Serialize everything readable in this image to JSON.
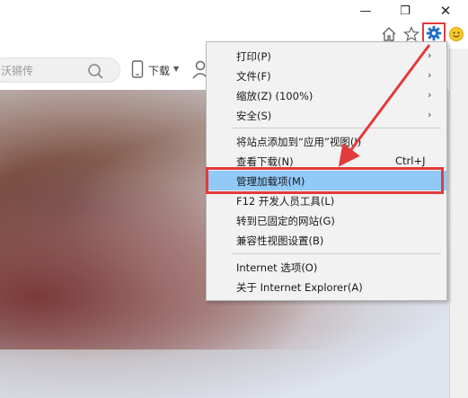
{
  "window": {
    "minimize_glyph": "—",
    "restore_glyph": "❐",
    "close_glyph": "✕"
  },
  "toolbar": {
    "icons": [
      "home-icon",
      "star-icon",
      "gear-icon",
      "smile-icon"
    ]
  },
  "page": {
    "search_placeholder": "沃锵传",
    "download_label": "下载"
  },
  "menu": {
    "items": [
      {
        "label": "打印(P)",
        "arrow": "›"
      },
      {
        "label": "文件(F)",
        "arrow": "›"
      },
      {
        "label": "缩放(Z) (100%)",
        "arrow": "›"
      },
      {
        "label": "安全(S)",
        "arrow": "›"
      },
      {
        "label": "将站点添加到“应用”视图(I)"
      },
      {
        "label": "查看下载(N)",
        "shortcut": "Ctrl+J"
      },
      {
        "label": "管理加载项(M)",
        "highlighted": true
      },
      {
        "label": "F12 开发人员工具(L)"
      },
      {
        "label": "转到已固定的网站(G)"
      },
      {
        "label": "兼容性视图设置(B)"
      },
      {
        "label": "Internet 选项(O)"
      },
      {
        "label": "关于 Internet Explorer(A)"
      }
    ]
  },
  "colors": {
    "annotation_red": "#e23b3b",
    "highlight_blue": "#91c9f7",
    "gear_blue": "#1f6fc4"
  }
}
